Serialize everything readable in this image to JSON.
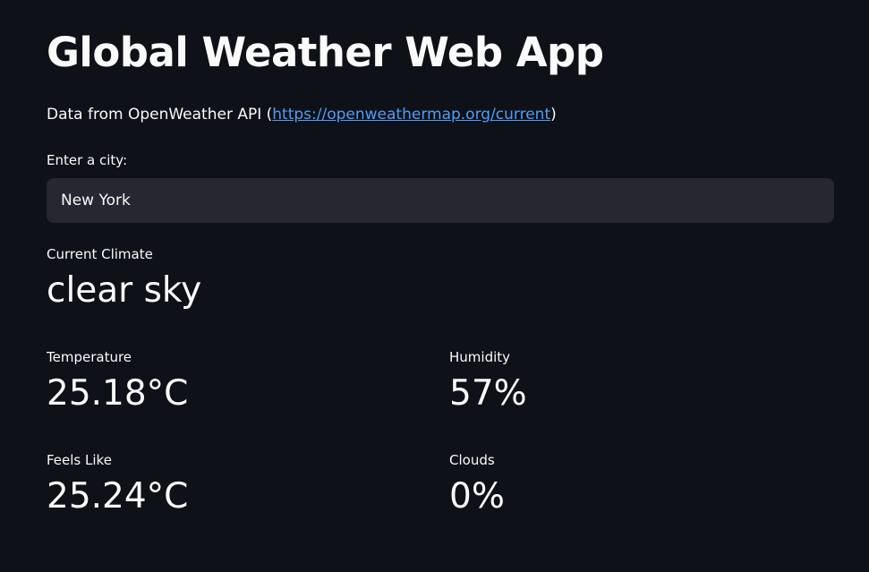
{
  "header": {
    "title": "Global Weather Web App",
    "subtitle_prefix": "Data from OpenWeather API (",
    "subtitle_link": "https://openweathermap.org/current",
    "subtitle_suffix": ")"
  },
  "city_input": {
    "label": "Enter a city:",
    "value": "New York"
  },
  "metrics": {
    "climate": {
      "label": "Current Climate",
      "value": "clear sky"
    },
    "temperature": {
      "label": "Temperature",
      "value": "25.18°C"
    },
    "humidity": {
      "label": "Humidity",
      "value": "57%"
    },
    "feels_like": {
      "label": "Feels Like",
      "value": "25.24°C"
    },
    "clouds": {
      "label": "Clouds",
      "value": "0%"
    }
  },
  "colors": {
    "background": "#0e1117",
    "input_background": "#262730",
    "text": "#fafafa",
    "link": "#4f9dfb"
  }
}
